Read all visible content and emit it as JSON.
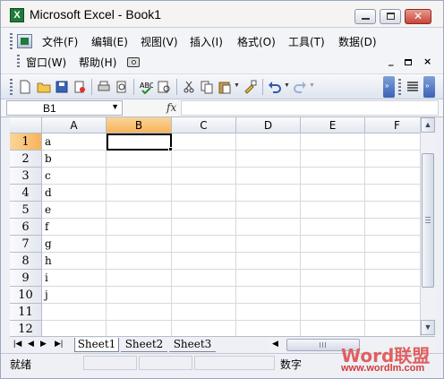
{
  "window": {
    "title": "Microsoft Excel - Book1",
    "app_icon": "X"
  },
  "menu": {
    "row1": [
      "文件(F)",
      "编辑(E)",
      "视图(V)",
      "插入(I)",
      "格式(O)",
      "工具(T)",
      "数据(D)"
    ],
    "row2": [
      "窗口(W)",
      "帮助(H)"
    ],
    "mdi_min": "_",
    "mdi_restore": "×"
  },
  "formula_bar": {
    "name_box": "B1",
    "fx": "fx",
    "formula": ""
  },
  "columns": [
    "A",
    "B",
    "C",
    "D",
    "E",
    "F"
  ],
  "selected_column": "B",
  "rows": [
    {
      "num": "1",
      "a": "a"
    },
    {
      "num": "2",
      "a": "b"
    },
    {
      "num": "3",
      "a": "c"
    },
    {
      "num": "4",
      "a": "d"
    },
    {
      "num": "5",
      "a": "e"
    },
    {
      "num": "6",
      "a": "f"
    },
    {
      "num": "7",
      "a": "g"
    },
    {
      "num": "8",
      "a": "h"
    },
    {
      "num": "9",
      "a": "i"
    },
    {
      "num": "10",
      "a": "j"
    },
    {
      "num": "11",
      "a": ""
    },
    {
      "num": "12",
      "a": ""
    }
  ],
  "sheets": [
    "Sheet1",
    "Sheet2",
    "Sheet3"
  ],
  "sheet_nav": [
    "|◀",
    "◀",
    "▶",
    "▶|"
  ],
  "status": {
    "ready": "就绪",
    "mode": "数字"
  },
  "watermark": {
    "word": "Word联盟",
    "url": "www.wordlm.com"
  },
  "colors": {
    "accent_selected_header": "#f7b35a",
    "title_close": "#c8453a"
  }
}
